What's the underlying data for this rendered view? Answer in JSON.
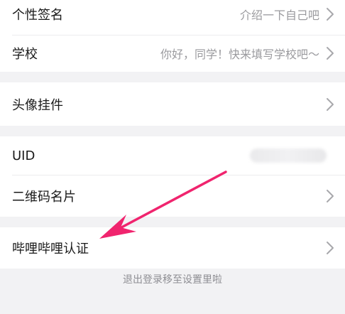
{
  "rows": {
    "signature": {
      "label": "个性签名",
      "value": "介绍一下自己吧"
    },
    "school": {
      "label": "学校",
      "value": "你好，同学！快来填写学校吧～"
    },
    "avatar_pendant": {
      "label": "头像挂件"
    },
    "uid": {
      "label": "UID"
    },
    "qr_card": {
      "label": "二维码名片"
    },
    "certification": {
      "label": "哔哩哔哩认证"
    }
  },
  "footer": {
    "text": "退出登录移至设置里啦"
  },
  "colors": {
    "background": "#f2f2f4",
    "row_background": "#ffffff",
    "label_text": "#1a1a1a",
    "value_text": "#9a9a9e",
    "chevron": "#a8a8ac",
    "annotation_arrow": "#f0246e"
  },
  "icons": {
    "chevron": "chevron-right-icon",
    "annotation": "annotation-arrow"
  }
}
